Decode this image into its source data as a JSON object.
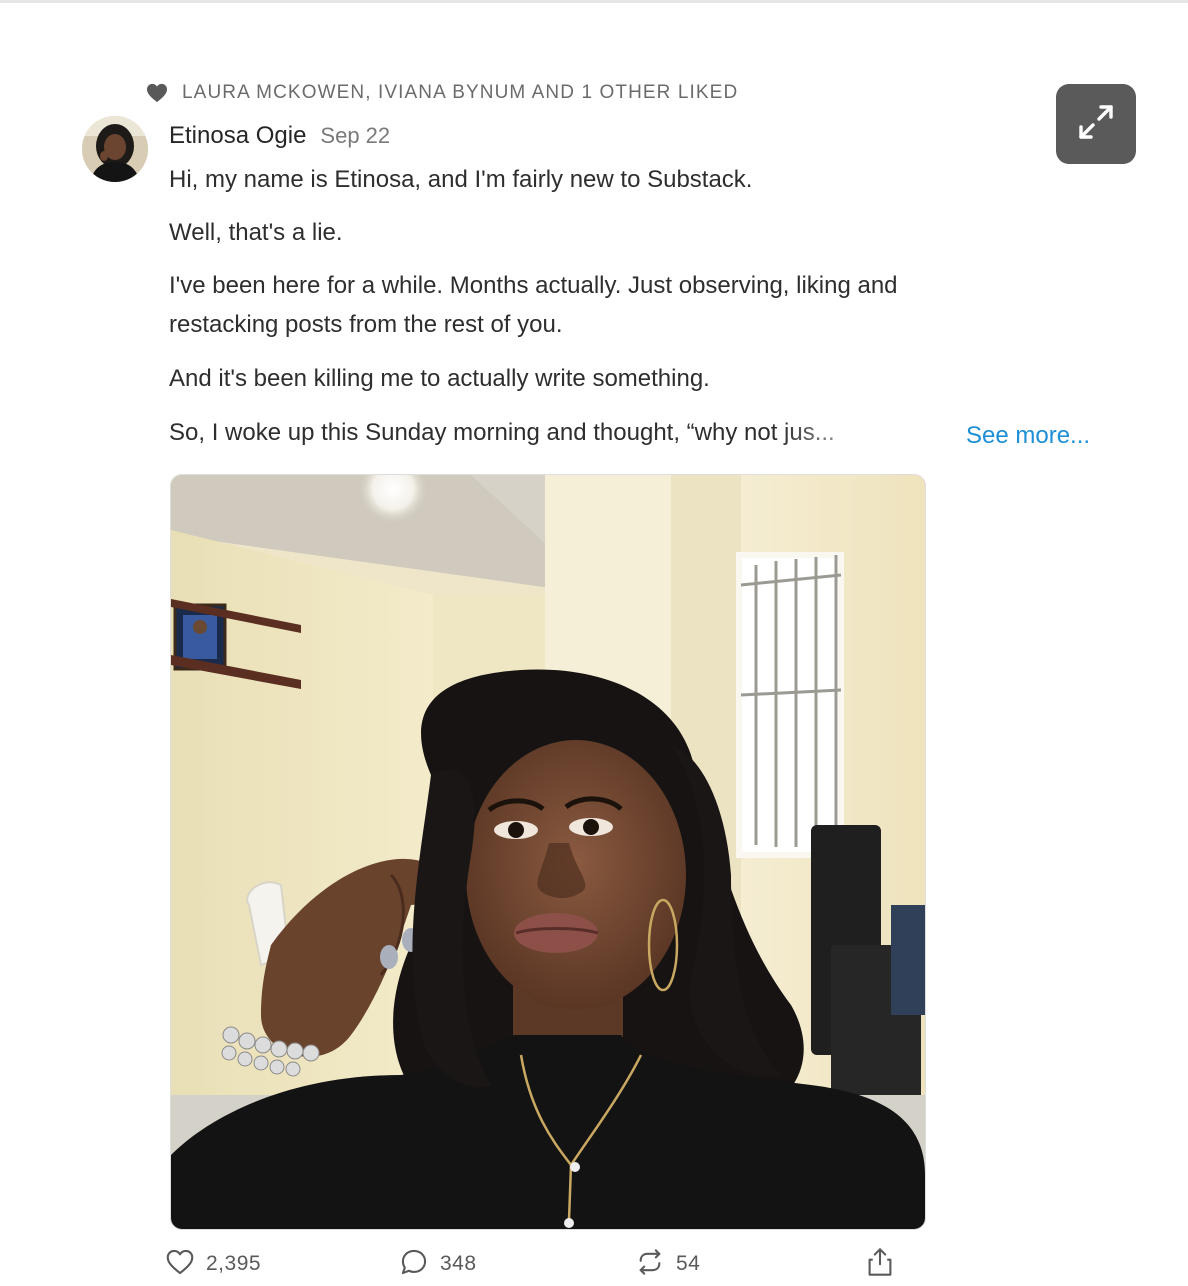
{
  "liked_by": {
    "text": "LAURA MCKOWEN, IVIANA BYNUM AND 1 OTHER LIKED",
    "icon": "heart-icon"
  },
  "post": {
    "author": "Etinosa Ogie",
    "date": "Sep 22",
    "paragraphs": [
      "Hi, my name is Etinosa, and I'm fairly new to Substack.",
      "Well, that's a lie.",
      "I've been here for a while. Months actually. Just observing, liking and restacking posts from the rest of you.",
      "And it's been killing me to actually write something.",
      "So, I woke up this Sunday morning and thought, “why not jus..."
    ],
    "paragraph_3_lines": [
      "I've been here for a while. Months actually. Just observing, liking and",
      "restacking posts from the rest of you."
    ],
    "see_more_label": "See more...",
    "expand_icon": "expand-arrows-icon"
  },
  "actions": {
    "likes": "2,395",
    "comments": "348",
    "restacks": "54"
  },
  "colors": {
    "link": "#1d8fd6",
    "muted": "#6b6b6b",
    "expand_bg": "#5a5a5a"
  }
}
